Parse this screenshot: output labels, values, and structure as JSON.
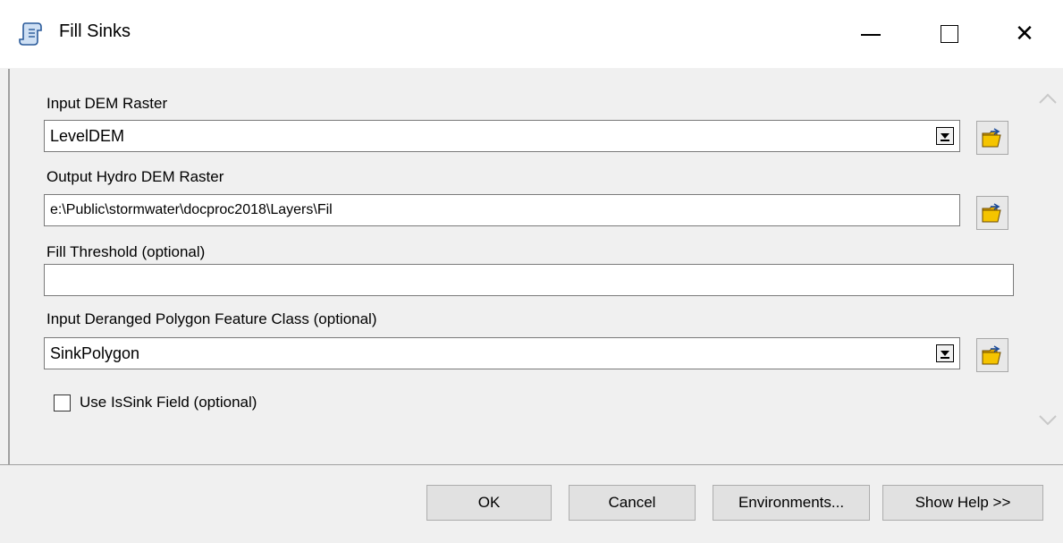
{
  "window": {
    "title": "Fill Sinks",
    "icon": "script-tool-icon",
    "close_glyph": "✕"
  },
  "form": {
    "input_dem_label": "Input DEM Raster",
    "input_dem_value": "LevelDEM",
    "output_hydro_label": "Output Hydro DEM Raster",
    "output_hydro_value": "e:\\Public\\stormwater\\docproc2018\\Layers\\Fil",
    "fill_threshold_label": "Fill Threshold (optional)",
    "fill_threshold_value": "",
    "deranged_polygon_label": "Input Deranged Polygon Feature Class (optional)",
    "deranged_polygon_value": "SinkPolygon",
    "use_issink_label": "Use IsSink Field (optional)",
    "use_issink_checked": false
  },
  "footer": {
    "ok_label": "OK",
    "cancel_label": "Cancel",
    "environments_label": "Environments...",
    "show_help_label": "Show Help >>"
  }
}
